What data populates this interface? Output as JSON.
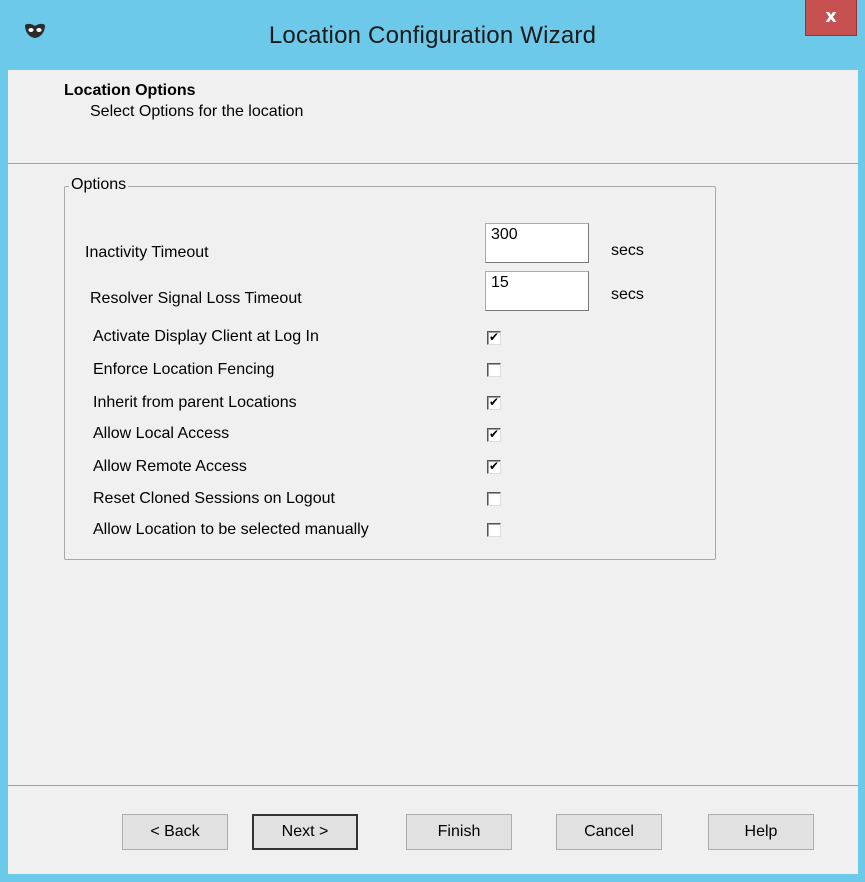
{
  "window": {
    "title": "Location Configuration Wizard",
    "close_label": "x",
    "app_icon": "mask-icon"
  },
  "header": {
    "title": "Location Options",
    "subtitle": "Select Options for the location"
  },
  "options": {
    "group_label": "Options",
    "inactivity_timeout": {
      "label": "Inactivity Timeout",
      "value": "300",
      "unit": "secs"
    },
    "resolver_timeout": {
      "label": "Resolver Signal Loss Timeout",
      "value": "15",
      "unit": "secs"
    },
    "checkboxes": [
      {
        "label": "Activate Display Client at Log In",
        "checked": true
      },
      {
        "label": "Enforce Location Fencing",
        "checked": false
      },
      {
        "label": "Inherit from parent Locations",
        "checked": true
      },
      {
        "label": "Allow Local Access",
        "checked": true
      },
      {
        "label": "Allow Remote Access",
        "checked": true
      },
      {
        "label": "Reset Cloned Sessions on Logout",
        "checked": false
      },
      {
        "label": "Allow Location to be selected manually",
        "checked": false
      }
    ]
  },
  "buttons": {
    "back": "< Back",
    "next": "Next >",
    "finish": "Finish",
    "cancel": "Cancel",
    "help": "Help"
  },
  "colors": {
    "titlebar": "#6cc9ea",
    "close": "#c75050",
    "dialog_bg": "#f0f0f0"
  }
}
